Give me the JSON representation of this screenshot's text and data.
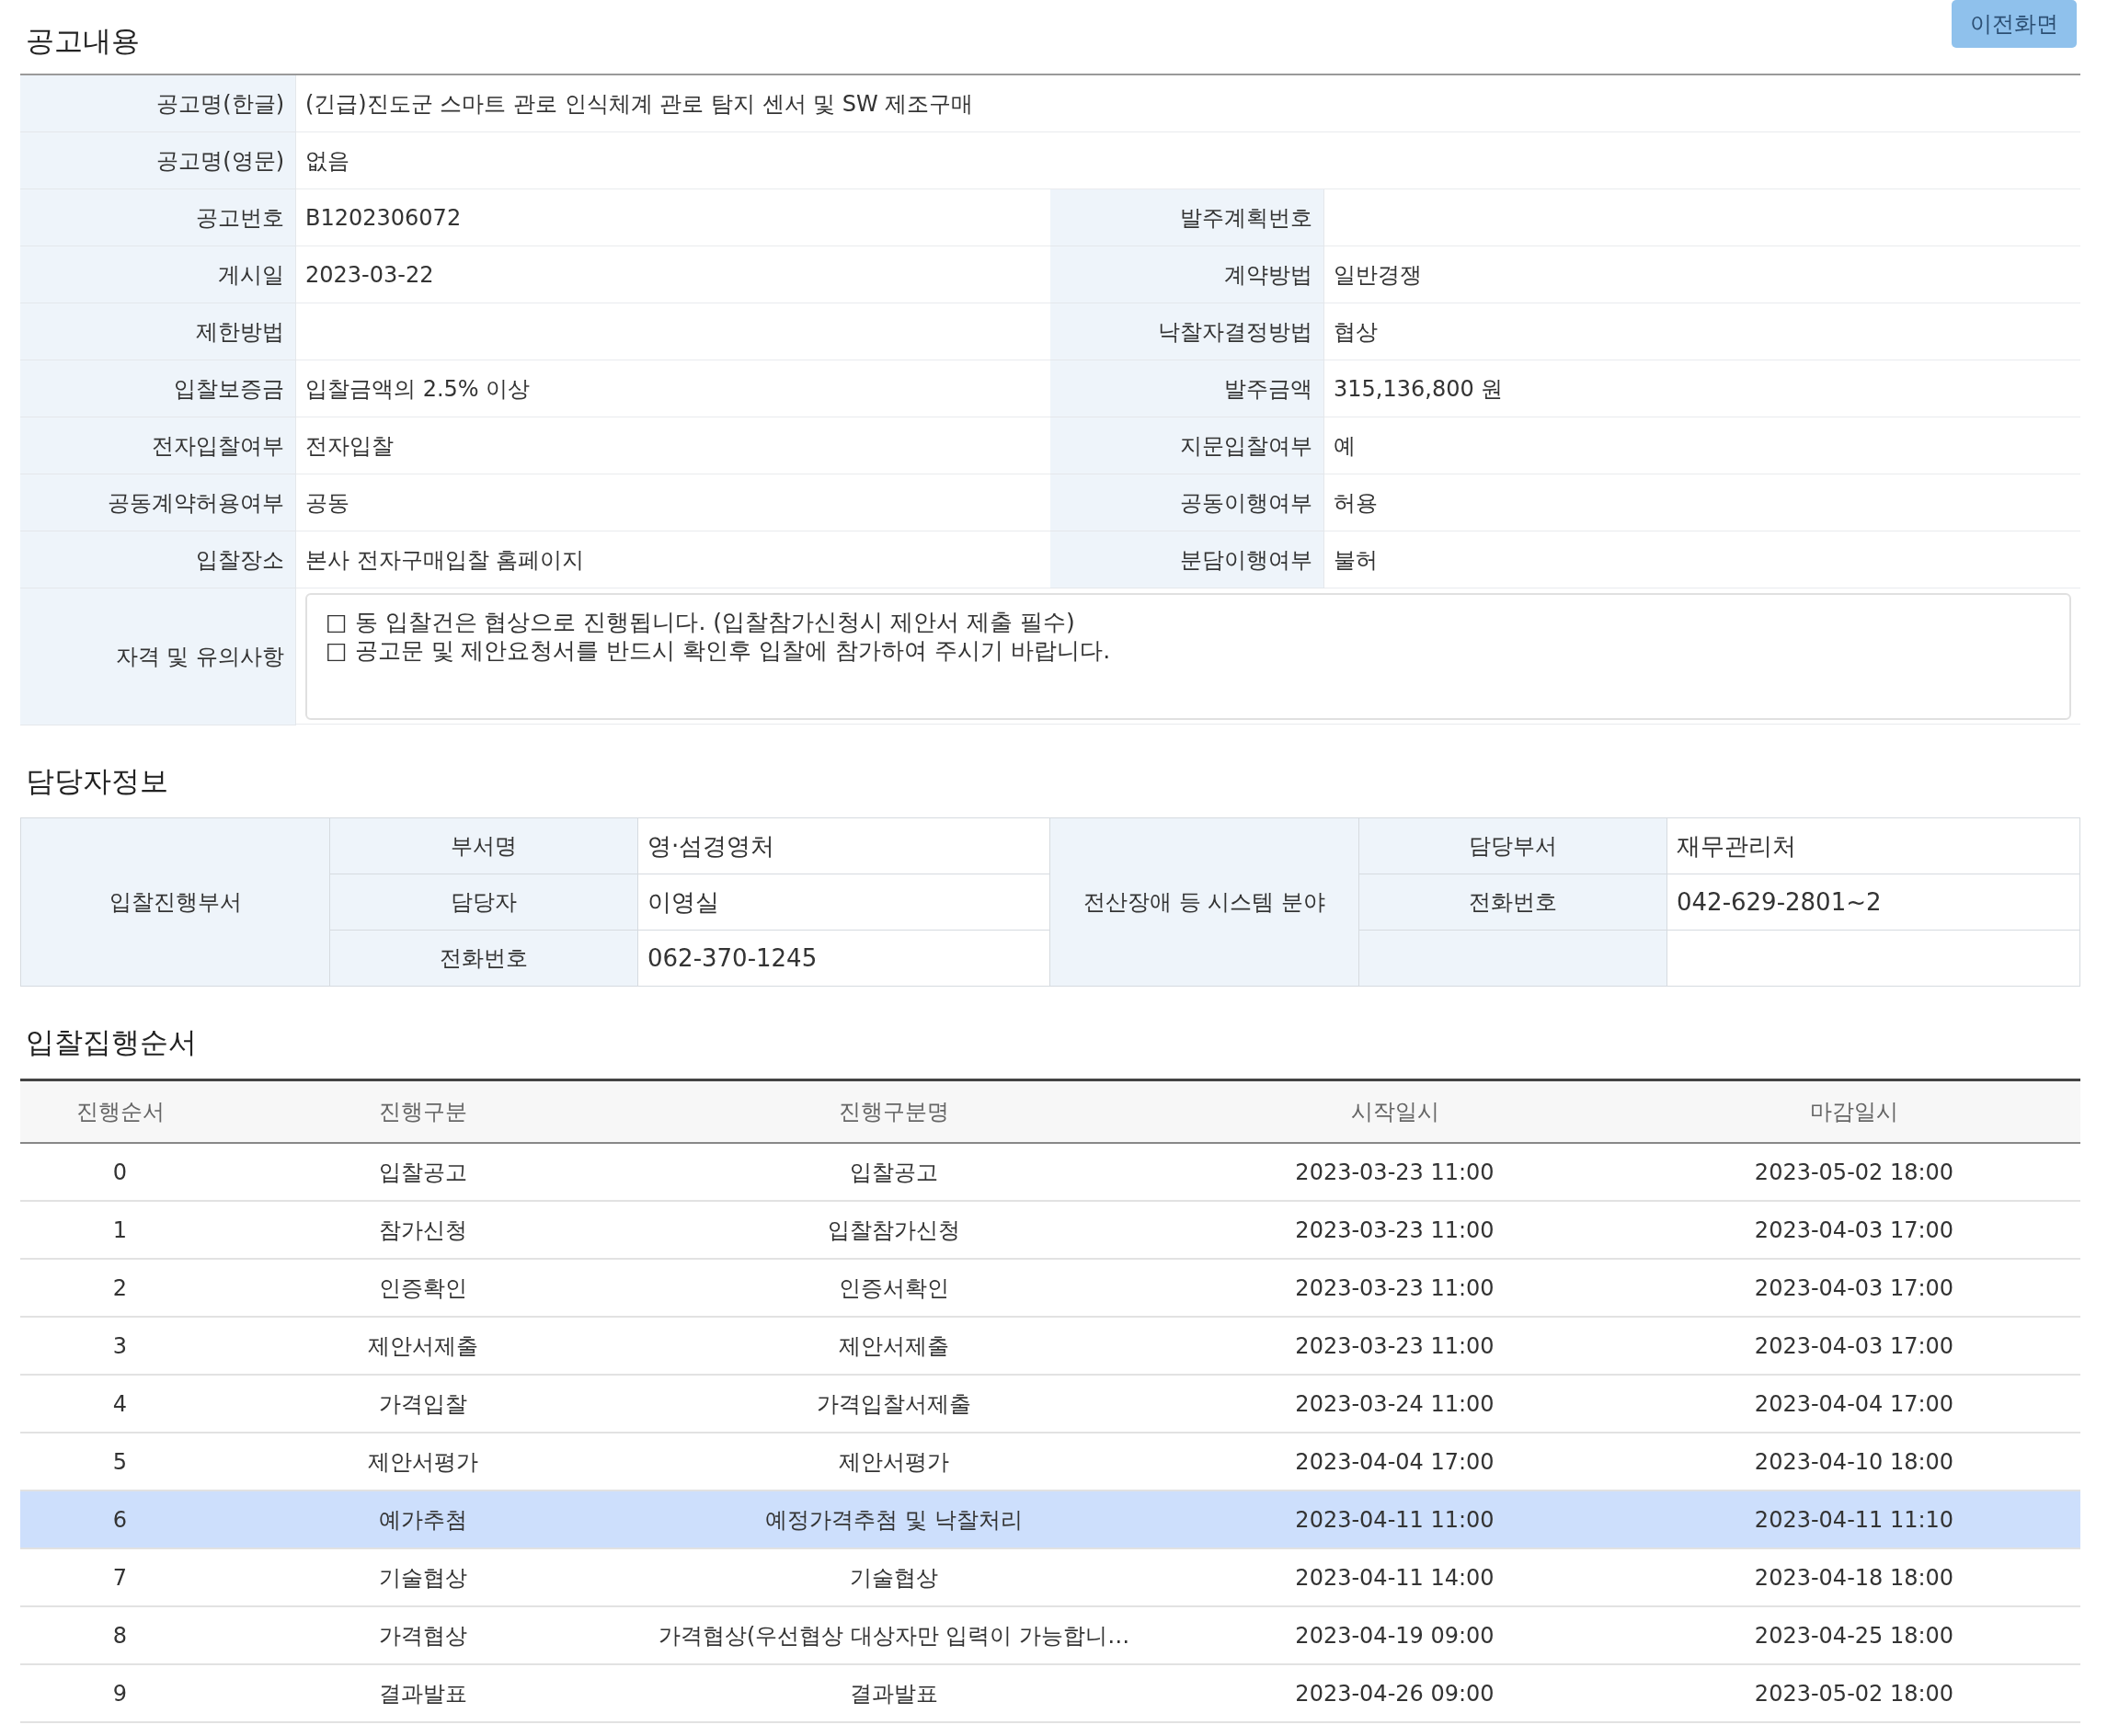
{
  "notice": {
    "title": "공고내용",
    "back_button": "이전화면",
    "rows": [
      {
        "pairs": [
          {
            "label": "공고명(한글)",
            "value": "(긴급)진도군 스마트 관로 인식체계 관로 탐지 센서 및 SW 제조구매"
          }
        ]
      },
      {
        "pairs": [
          {
            "label": "공고명(영문)",
            "value": "없음"
          }
        ]
      },
      {
        "pairs": [
          {
            "label": "공고번호",
            "value": "B1202306072"
          },
          {
            "label": "발주계획번호"
          }
        ]
      },
      {
        "pairs": [
          {
            "label": "게시일",
            "value": "2023-03-22"
          },
          {
            "label": "계약방법",
            "value": "일반경쟁"
          }
        ]
      },
      {
        "pairs": [
          {
            "label": "제한방법"
          },
          {
            "label": "낙찰자결정방법",
            "value": "협상"
          }
        ]
      },
      {
        "pairs": [
          {
            "label": "입찰보증금",
            "value": "입찰금액의 2.5% 이상"
          },
          {
            "label": "발주금액",
            "value": "315,136,800 원"
          }
        ]
      },
      {
        "pairs": [
          {
            "label": "전자입찰여부",
            "value": "전자입찰"
          },
          {
            "label": "지문입찰여부",
            "value": "예"
          }
        ]
      },
      {
        "pairs": [
          {
            "label": "공동계약허용여부",
            "value": "공동"
          },
          {
            "label": "공동이행여부",
            "value": "허용"
          }
        ]
      },
      {
        "pairs": [
          {
            "label": "입찰장소",
            "value": "본사 전자구매입찰 홈페이지"
          },
          {
            "label": "분담이행여부",
            "value": "불허"
          }
        ]
      }
    ],
    "notes": {
      "label": "자격 및 유의사항",
      "lines": [
        "□ 동 입찰건은 협상으로 진행됩니다. (입찰참가신청시 제안서 제출 필수)",
        "□ 공고문 및 제안요청서를 반드시 확인후 입찰에 참가하여 주시기 바랍니다."
      ]
    }
  },
  "contact": {
    "title": "담당자정보",
    "groups": [
      {
        "label": "입찰진행부서",
        "rows": [
          {
            "label": "부서명",
            "value": "영·섬경영처"
          },
          {
            "label": "담당자",
            "value": "이영실"
          },
          {
            "label": "전화번호",
            "value": "062-370-1245"
          }
        ]
      },
      {
        "label": "전산장애 등 시스템 분야",
        "rows": [
          {
            "label": "담당부서",
            "value": "재무관리처"
          },
          {
            "label": "전화번호",
            "value": "042-629-2801~2"
          }
        ]
      }
    ]
  },
  "schedule": {
    "title": "입찰집행순서",
    "columns": [
      "진행순서",
      "진행구분",
      "진행구분명",
      "시작일시",
      "마감일시"
    ],
    "rows": [
      {
        "cells": [
          "0",
          "입찰공고",
          "입찰공고",
          "2023-03-23 11:00",
          "2023-05-02 18:00"
        ],
        "selected": false
      },
      {
        "cells": [
          "1",
          "참가신청",
          "입찰참가신청",
          "2023-03-23 11:00",
          "2023-04-03 17:00"
        ],
        "selected": false
      },
      {
        "cells": [
          "2",
          "인증확인",
          "인증서확인",
          "2023-03-23 11:00",
          "2023-04-03 17:00"
        ],
        "selected": false
      },
      {
        "cells": [
          "3",
          "제안서제출",
          "제안서제출",
          "2023-03-23 11:00",
          "2023-04-03 17:00"
        ],
        "selected": false
      },
      {
        "cells": [
          "4",
          "가격입찰",
          "가격입찰서제출",
          "2023-03-24 11:00",
          "2023-04-04 17:00"
        ],
        "selected": false
      },
      {
        "cells": [
          "5",
          "제안서평가",
          "제안서평가",
          "2023-04-04 17:00",
          "2023-04-10 18:00"
        ],
        "selected": false
      },
      {
        "cells": [
          "6",
          "예가추첨",
          "예정가격추첨 및 낙찰처리",
          "2023-04-11 11:00",
          "2023-04-11 11:10"
        ],
        "selected": true
      },
      {
        "cells": [
          "7",
          "기술협상",
          "기술협상",
          "2023-04-11 14:00",
          "2023-04-18 18:00"
        ],
        "selected": false
      },
      {
        "cells": [
          "8",
          "가격협상",
          "가격협상(우선협상 대상자만 입력이 가능합니…",
          "2023-04-19 09:00",
          "2023-04-25 18:00"
        ],
        "selected": false
      },
      {
        "cells": [
          "9",
          "결과발표",
          "결과발표",
          "2023-04-26 09:00",
          "2023-05-02 18:00"
        ],
        "selected": false
      }
    ]
  }
}
